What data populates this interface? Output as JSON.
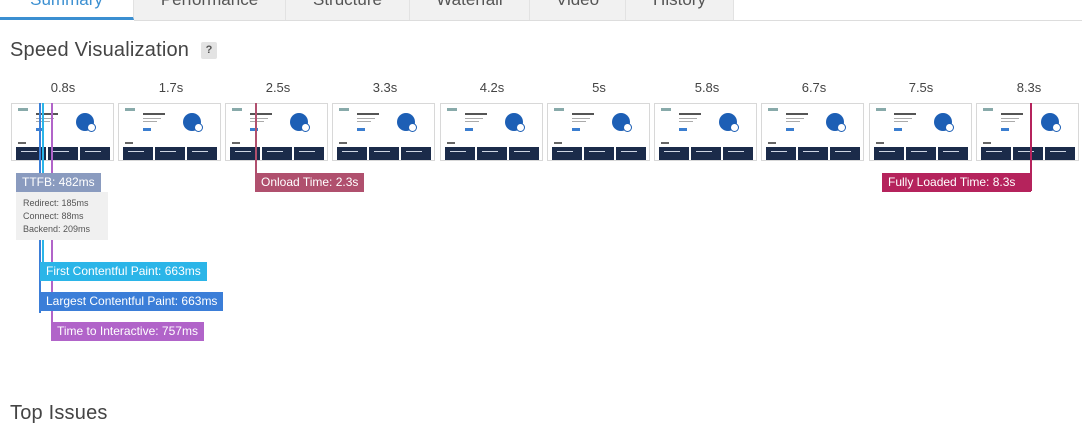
{
  "tabs": [
    {
      "label": "Summary",
      "active": true
    },
    {
      "label": "Performance",
      "active": false
    },
    {
      "label": "Structure",
      "active": false
    },
    {
      "label": "Waterfall",
      "active": false
    },
    {
      "label": "Video",
      "active": false
    },
    {
      "label": "History",
      "active": false
    }
  ],
  "speed_visualization": {
    "title": "Speed Visualization",
    "help_label": "?",
    "time_labels": [
      "0.8s",
      "1.7s",
      "2.5s",
      "3.3s",
      "4.2s",
      "5s",
      "5.8s",
      "6.7s",
      "7.5s",
      "8.3s"
    ],
    "markers": {
      "ttfb": {
        "label": "TTFB: 482ms",
        "color": "#8a9bbf"
      },
      "onload": {
        "label": "Onload Time: 2.3s",
        "color": "#b0506e"
      },
      "fully_loaded": {
        "label": "Fully Loaded Time: 8.3s",
        "color": "#b5235c"
      },
      "fcp": {
        "label": "First Contentful Paint: 663ms",
        "color": "#2bb5e8"
      },
      "lcp": {
        "label": "Largest Contentful Paint: 663ms",
        "color": "#3b7ed8"
      },
      "tti": {
        "label": "Time to Interactive: 757ms",
        "color": "#b164c9"
      }
    },
    "ttfb_breakdown": {
      "redirect": "Redirect: 185ms",
      "connect": "Connect: 88ms",
      "backend": "Backend: 209ms"
    }
  },
  "top_issues": {
    "title": "Top Issues"
  }
}
